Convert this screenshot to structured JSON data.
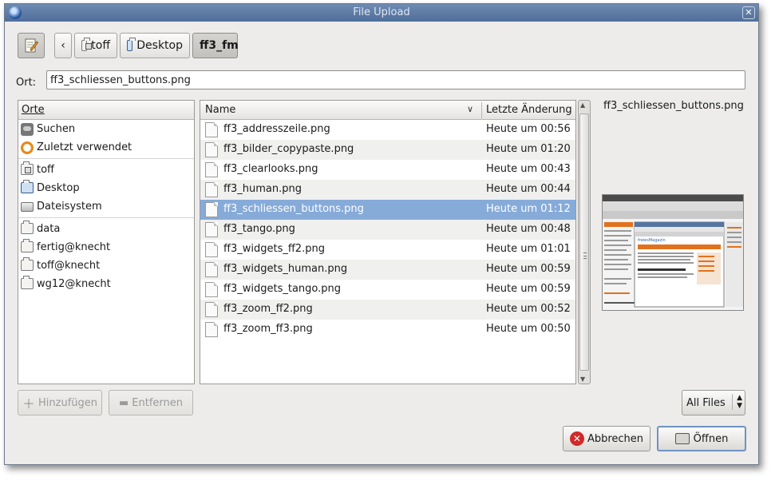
{
  "window": {
    "title": "File Upload"
  },
  "path_bar": {
    "back": "‹",
    "crumbs": [
      {
        "label": "toff"
      },
      {
        "label": "Desktop"
      },
      {
        "label": "ff3_fm"
      }
    ]
  },
  "location": {
    "label": "Ort:",
    "value": "ff3_schliessen_buttons.png"
  },
  "places": {
    "header": "Orte",
    "items": [
      {
        "label": "Suchen"
      },
      {
        "label": "Zuletzt verwendet"
      },
      {
        "label": "toff"
      },
      {
        "label": "Desktop"
      },
      {
        "label": "Dateisystem"
      },
      {
        "label": "data"
      },
      {
        "label": "fertig@knecht"
      },
      {
        "label": "toff@knecht"
      },
      {
        "label": "wg12@knecht"
      }
    ]
  },
  "files": {
    "col_name": "Name",
    "col_date": "Letzte Änderung",
    "sort_indicator": "∨",
    "rows": [
      {
        "name": "ff3_addresszeile.png",
        "date": "Heute um 00:56"
      },
      {
        "name": "ff3_bilder_copypaste.png",
        "date": "Heute um 01:20"
      },
      {
        "name": "ff3_clearlooks.png",
        "date": "Heute um 00:43"
      },
      {
        "name": "ff3_human.png",
        "date": "Heute um 00:44"
      },
      {
        "name": "ff3_schliessen_buttons.png",
        "date": "Heute um 01:12"
      },
      {
        "name": "ff3_tango.png",
        "date": "Heute um 00:48"
      },
      {
        "name": "ff3_widgets_ff2.png",
        "date": "Heute um 01:01"
      },
      {
        "name": "ff3_widgets_human.png",
        "date": "Heute um 00:59"
      },
      {
        "name": "ff3_widgets_tango.png",
        "date": "Heute um 00:59"
      },
      {
        "name": "ff3_zoom_ff2.png",
        "date": "Heute um 00:52"
      },
      {
        "name": "ff3_zoom_ff3.png",
        "date": "Heute um 00:50"
      }
    ],
    "selected_index": 4
  },
  "preview": {
    "filename": "ff3_schliessen_buttons.png",
    "thumb_brand": "freiesMagazin"
  },
  "buttons": {
    "add": "Hinzufügen",
    "remove": "Entfernen",
    "filter": "All Files",
    "cancel": "Abbrechen",
    "open": "Öffnen"
  },
  "colors": {
    "selection": "#86abd9",
    "titlebar": "#5b7aa6",
    "default_button_border": "#6f92c3"
  }
}
